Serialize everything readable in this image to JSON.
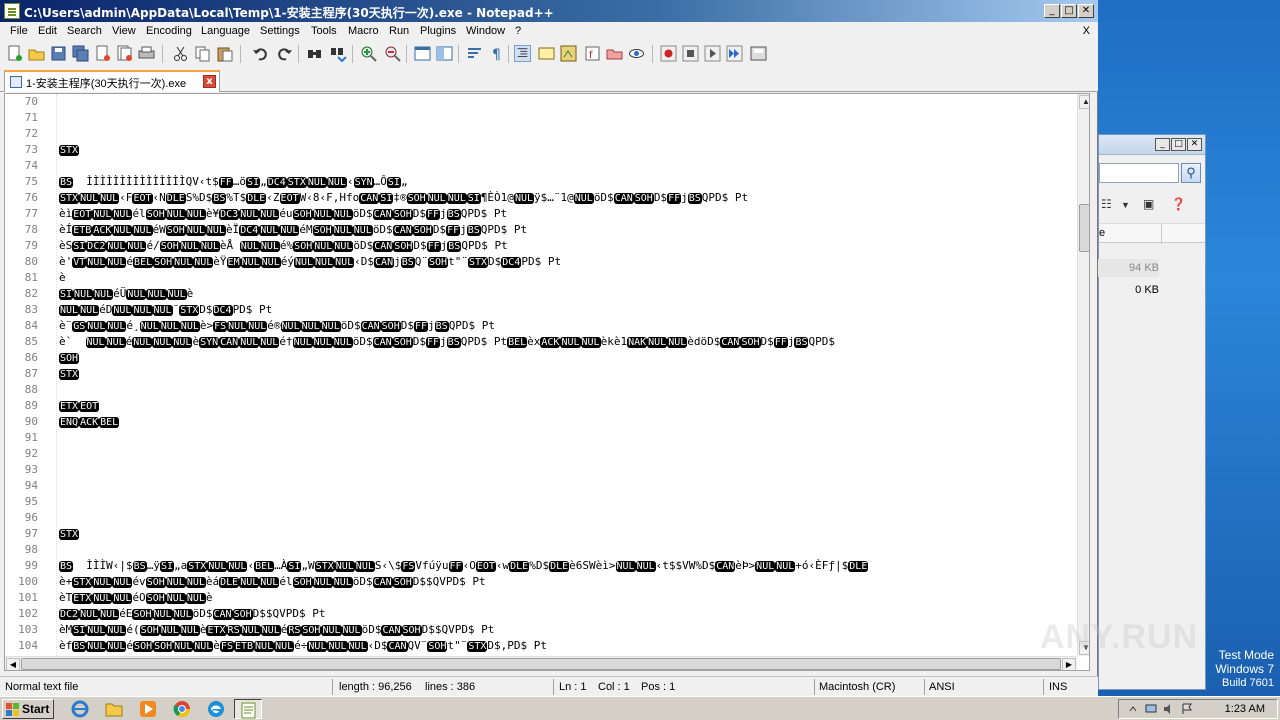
{
  "window": {
    "title": "C:\\Users\\admin\\AppData\\Local\\Temp\\1-安装主程序(30天执行一次).exe - Notepad++",
    "menu": [
      "File",
      "Edit",
      "Search",
      "View",
      "Encoding",
      "Language",
      "Settings",
      "Tools",
      "Macro",
      "Run",
      "Plugins",
      "Window",
      "?"
    ],
    "close_doc": "X"
  },
  "tab": {
    "label": "1-安装主程序(30天执行一次).exe",
    "close": "x"
  },
  "editor": {
    "lines": [
      {
        "n": "70",
        "t": ""
      },
      {
        "n": "71",
        "t": ""
      },
      {
        "n": "72",
        "t": ""
      },
      {
        "n": "73",
        "t": "[STX]"
      },
      {
        "n": "74",
        "t": ""
      },
      {
        "n": "75",
        "t": "[BS]  ÌÌÌÌÌÌÌÌÌÌÌÌÌÌÌQV‹t$[FF]…ö[SI]„[DC4][STX][NUL][NUL]‹[SYN]…Ô[SI]„"
      },
      {
        "n": "76",
        "t": "[STX][NUL][NUL]‹F[EOT]‹N[DLE]S%D$[BS]%T$[DLE]‹Z[EOT]W‹8‹F,Hfo[CAN][SI]‡®[SOH][NUL][NUL][SI]¶ÈÒ1@[NUL]ÿ$…¨1@[NUL]öD$[CAN][SOH]D$[FF]j[BS]QPD$ Pt"
      },
      {
        "n": "77",
        "t": "èì[EOT][NUL][NUL]él[SOH][NUL][NUL]è¥[DC3][NUL][NUL]éu[SOH][NUL][NUL]öD$[CAN][SOH]D$[FF]j[BS]QPD$ Pt"
      },
      {
        "n": "78",
        "t": "èÍ[ETB][ACK][NUL][NUL]éW[SOH][NUL][NUL]èÏ[DC4][NUL][NUL]éM[SOH][NUL][NUL]öD$[CAN][SOH]D$[FF]j[BS]QPD$ Pt"
      },
      {
        "n": "79",
        "t": "èS[SI][DC2][NUL][NUL]é/[SOH][NUL][NUL]èÅ [NUL][NUL]é%[SOH][NUL][NUL]öD$[CAN][SOH]D$[FF]j[BS]QPD$ Pt"
      },
      {
        "n": "80",
        "t": "è'[VT][NUL][NUL]é[BEL][SOH][NUL][NUL]èŸ[EM][NUL][NUL]éý[NUL][NUL][NUL]‹D$[CAN]j[BS]Q¨[SOH]t\"¨[STX]D$[DC4]PD$ Pt"
      },
      {
        "n": "81",
        "t": "è"
      },
      {
        "n": "82",
        "t": "[SI][NUL][NUL]éÜ[NUL][NUL][NUL]è"
      },
      {
        "n": "83",
        "t": "[NUL][NUL]éD[NUL][NUL][NUL]¨[STX]D$[DC4]PD$ Pt"
      },
      {
        "n": "84",
        "t": "è¨[GS][NUL][NUL]é¸[NUL][NUL][NUL]è>[FS][NUL][NUL]é®[NUL][NUL][NUL]öD$[CAN][SOH]D$[FF]j[BS]QPD$ Pt"
      },
      {
        "n": "85",
        "t": "è`  [NUL][NUL]é[NUL][NUL][NUL]è[SYN][CAN][NUL][NUL]é†[NUL][NUL][NUL]öD$[CAN][SOH]D$[FF]j[BS]QPD$ Pt[BEL]èx[ACK][NUL][NUL]èkè1[NAK][NUL][NUL]èdöD$[CAN][SOH]D$[FF]j[BS]QPD$"
      },
      {
        "n": "86",
        "t": "[SOH]"
      },
      {
        "n": "87",
        "t": "[STX]"
      },
      {
        "n": "88",
        "t": ""
      },
      {
        "n": "89",
        "t": "[ETX][EOT]"
      },
      {
        "n": "90",
        "t": "[ENQ][ACK][BEL]"
      },
      {
        "n": "91",
        "t": ""
      },
      {
        "n": "92",
        "t": ""
      },
      {
        "n": "93",
        "t": ""
      },
      {
        "n": "94",
        "t": ""
      },
      {
        "n": "95",
        "t": ""
      },
      {
        "n": "96",
        "t": ""
      },
      {
        "n": "97",
        "t": "[STX]"
      },
      {
        "n": "98",
        "t": ""
      },
      {
        "n": "99",
        "t": "[BS]  ÌÌÌW‹|$[BS]…ÿ[SI]„a[STX][NUL][NUL]‹[BEL]…À[SI]„W[STX][NUL][NUL]S‹\\$[FS]Vfúÿu[FF]‹O[EOT]‹w[DLE]%D$[DLE]è6SWèì>[NUL][NUL]‹t$$VW%D$[CAN]èÞ>[NUL][NUL]+ó‹ÈFƒ|$[DLE]"
      },
      {
        "n": "100",
        "t": "è+[STX][NUL][NUL]év[SOH][NUL][NUL]èá[DLE][NUL][NUL]él[SOH][NUL][NUL]öD$[CAN][SOH]D$$QVPD$ Pt"
      },
      {
        "n": "101",
        "t": "èT[ETX][NUL][NUL]éO[SOH][NUL][NUL]è"
      },
      {
        "n": "102",
        "t": "[DC2][NUL][NUL]éE[SOH][NUL][NUL]öD$[CAN][SOH]D$$QVPD$ Pt"
      },
      {
        "n": "103",
        "t": "èM[SI][NUL][NUL]é([SOH][NUL][NUL]è[ETX][RS][NUL][NUL]é[RS][SOH][NUL][NUL]öD$[CAN][SOH]D$$QVPD$ Pt"
      },
      {
        "n": "104",
        "t": "èf[BS][NUL][NUL]é[SOH][SOH][NUL][NUL]è[FS][ETB][NUL][NUL]é÷[NUL][NUL][NUL]‹D$[CAN]QV¨[SOH]t\"¨[STX]D$,PD$ Pt"
      }
    ]
  },
  "status": {
    "type": "Normal text file",
    "length": "length : 96,256",
    "lines": "lines : 386",
    "ln": "Ln : 1",
    "col": "Col : 1",
    "pos": "Pos : 1",
    "eol": "Macintosh (CR)",
    "encoding": "ANSI",
    "mode": "INS"
  },
  "taskbar": {
    "start": "Start",
    "clock": "1:23 AM"
  },
  "explorer": {
    "col_header": "e",
    "sizes": [
      "94 KB",
      "0 KB"
    ]
  },
  "desktop": {
    "watermark": "ANY.RUN",
    "os_line1": "Test Mode",
    "os_line2": "Windows 7",
    "os_line3": "Build 7601"
  }
}
